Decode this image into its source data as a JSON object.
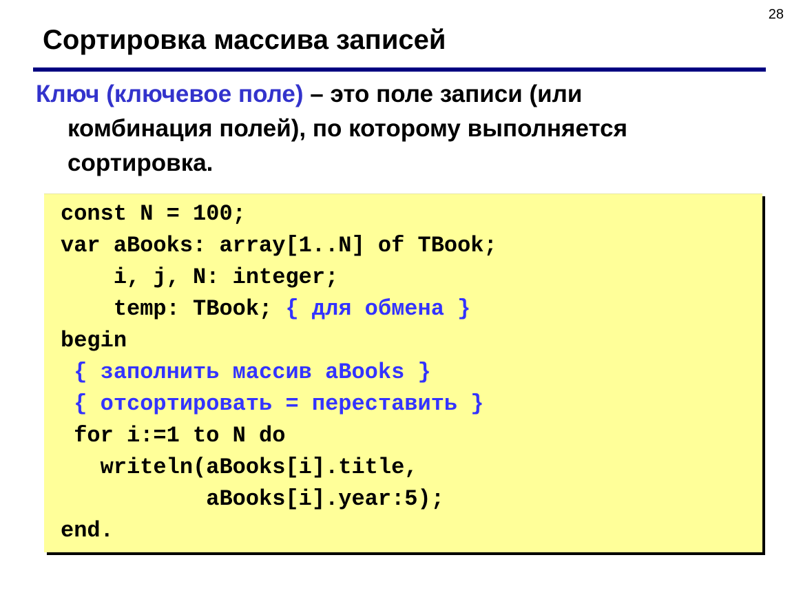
{
  "slide": {
    "page_number": "28",
    "title": "Сортировка массива записей",
    "definition": {
      "term": "Ключ (ключевое поле)",
      "rest_line1": " – это поле записи (или",
      "line2": "комбинация полей), по которому выполняется",
      "line3": "сортировка."
    },
    "code_lines": [
      {
        "indent": "",
        "code": "const N = 100;",
        "comment": ""
      },
      {
        "indent": "",
        "code": "var aBooks: array[1..N] of TBook;",
        "comment": ""
      },
      {
        "indent": "    ",
        "code": "i, j, N: integer;",
        "comment": ""
      },
      {
        "indent": "    ",
        "code": "temp: TBook; ",
        "comment": "{ для обмена }"
      },
      {
        "indent": "",
        "code": "begin",
        "comment": ""
      },
      {
        "indent": " ",
        "code": "",
        "comment": "{ заполнить массив aBooks }"
      },
      {
        "indent": " ",
        "code": "",
        "comment": "{ отсортировать = переставить }"
      },
      {
        "indent": " ",
        "code": "for i:=1 to N do",
        "comment": ""
      },
      {
        "indent": "   ",
        "code": "writeln(aBooks[i].title,",
        "comment": ""
      },
      {
        "indent": "           ",
        "code": "aBooks[i].year:5);",
        "comment": ""
      },
      {
        "indent": "",
        "code": "end.",
        "comment": ""
      }
    ]
  },
  "colors": {
    "rule": "#000080",
    "key_term": "#3333cc",
    "comment": "#3333ff",
    "code_bg": "#ffff99"
  }
}
